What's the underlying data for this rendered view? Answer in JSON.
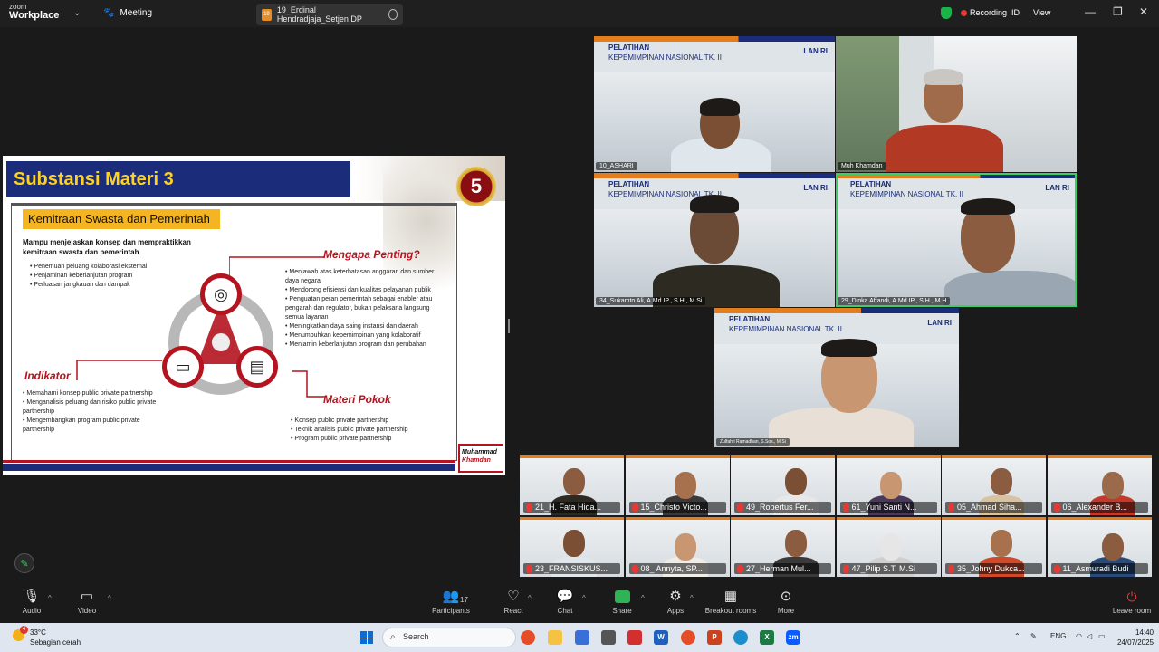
{
  "titlebar": {
    "logo_line1": "zoom",
    "logo_line2": "Workplace",
    "meeting_label": "Meeting",
    "tab_badge": "19",
    "tab_label": "19_Erdinal Hendradjaja_Setjen DP",
    "recording_label": "Recording",
    "id_label": "ID",
    "view_label": "View"
  },
  "slide": {
    "title": "Substansi Materi 3",
    "medal_number": "5",
    "subtitle": "Kemitraan Swasta dan Pemerintah",
    "intro": "Mampu menjelaskan konsep dan mempraktikkan kemitraan swasta dan pemerintah",
    "intro_bullets": [
      "Penemuan peluang kolaborasi eksternal",
      "Penjaminan keberlanjutan program",
      "Perluasan jangkauan dan dampak"
    ],
    "mengapa_heading": "Mengapa Penting?",
    "mengapa_bullets": [
      "Menjawab atas keterbatasan anggaran dan sumber daya negara",
      "Mendorong efisiensi dan kualitas pelayanan publik",
      "Penguatan peran pemerintah sebagai enabler atau pengarah dan regulator, bukan pelaksana langsung semua layanan",
      "Meningkatkan daya saing instansi dan daerah",
      "Menumbuhkan kepemimpinan yang kolaboratif",
      "Menjamin keberlanjutan program dan perubahan"
    ],
    "indikator_heading": "Indikator",
    "indikator_bullets": [
      "Memahami konsep public private partnership",
      "Menganalisis peluang dan risiko public private partnership",
      "Mengembangkan program public private partnership"
    ],
    "materi_heading": "Materi Pokok",
    "materi_bullets": [
      "Konsep public private partnership",
      "Teknik analisis public private partnership",
      "Program public private partnership"
    ],
    "signature_line1": "Muhammad",
    "signature_line2": "Khamdan"
  },
  "banner": {
    "line1": "PELATIHAN",
    "line2": "KEPEMIMPINAN NASIONAL TK. II",
    "lan": "LAN RI"
  },
  "big_tiles": [
    {
      "name": "10_ASHARI"
    },
    {
      "name": "Muh Khamdan"
    },
    {
      "name": "34_Sukamto Ali, A.Md.IP., S.H., M.Si"
    },
    {
      "name": "29_Dinka Affandi, A.Md.IP., S.H., M.H"
    },
    {
      "name": "Zulfahri Ramadhan, S.Sos., M.Si"
    }
  ],
  "gallery": [
    {
      "name": "21_H. Fata Hida..."
    },
    {
      "name": "15_Christo Victo..."
    },
    {
      "name": "49_Robertus Fer..."
    },
    {
      "name": "61_Yuni Santi N..."
    },
    {
      "name": "05_Ahmad Siha..."
    },
    {
      "name": "06_Alexander B..."
    },
    {
      "name": "23_FRANSISKUS..."
    },
    {
      "name": "08_ Annyta, SP..."
    },
    {
      "name": "27_Herman Mul..."
    },
    {
      "name": "47_Pilip S.T. M.Si"
    },
    {
      "name": "35_Johny Dukca..."
    },
    {
      "name": "11_Asmuradi Budi"
    }
  ],
  "toolbar": {
    "audio": "Audio",
    "video": "Video",
    "participants": "Participants",
    "participants_count": "17",
    "react": "React",
    "chat": "Chat",
    "share": "Share",
    "apps": "Apps",
    "breakout": "Breakout rooms",
    "more": "More",
    "leave": "Leave room"
  },
  "taskbar": {
    "weather_temp": "33°C",
    "weather_desc": "Sebagian cerah",
    "weather_badge": "4",
    "search_placeholder": "Search",
    "lang": "ENG",
    "time": "14:40",
    "date": "24/07/2025"
  }
}
